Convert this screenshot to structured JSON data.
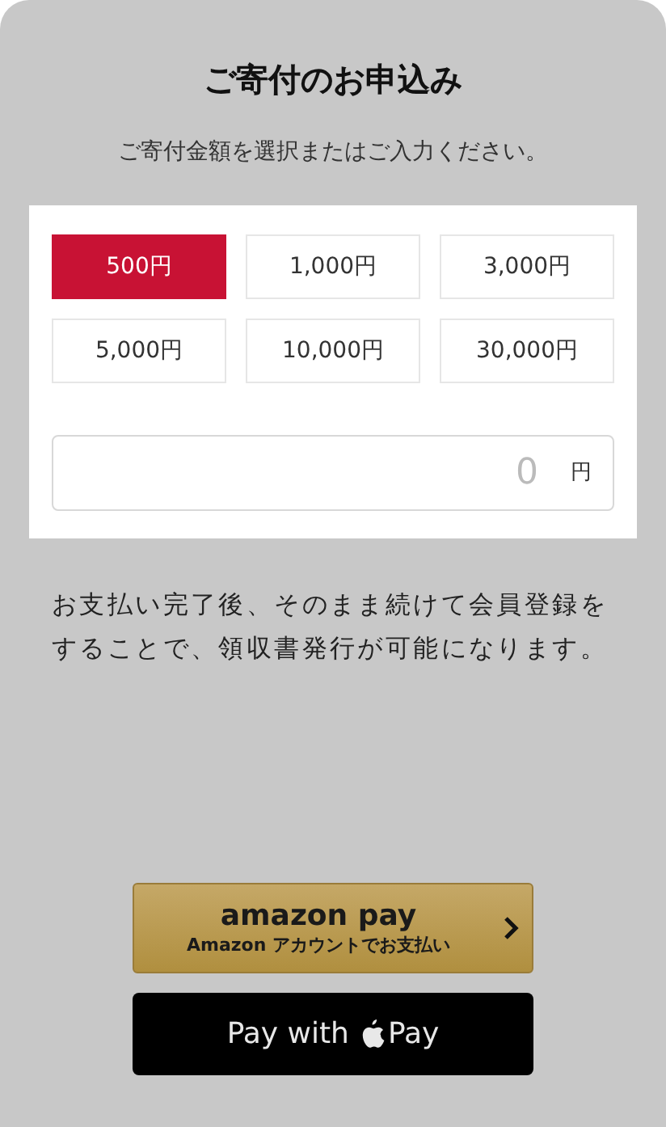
{
  "title": "ご寄付のお申込み",
  "instruction": "ご寄付金額を選択またはご入力ください。",
  "amounts": [
    {
      "label": "500円",
      "selected": true
    },
    {
      "label": "1,000円",
      "selected": false
    },
    {
      "label": "3,000円",
      "selected": false
    },
    {
      "label": "5,000円",
      "selected": false
    },
    {
      "label": "10,000円",
      "selected": false
    },
    {
      "label": "30,000円",
      "selected": false
    }
  ],
  "custom_amount": {
    "placeholder": "0",
    "unit": "円"
  },
  "note": "お支払い完了後、そのまま続けて会員登録をすることで、領収書発行が可能になります。",
  "amazon_pay": {
    "logo": "amazon pay",
    "label": "Amazon アカウントでお支払い"
  },
  "apple_pay": {
    "label": "Pay with",
    "brand": "Pay"
  }
}
